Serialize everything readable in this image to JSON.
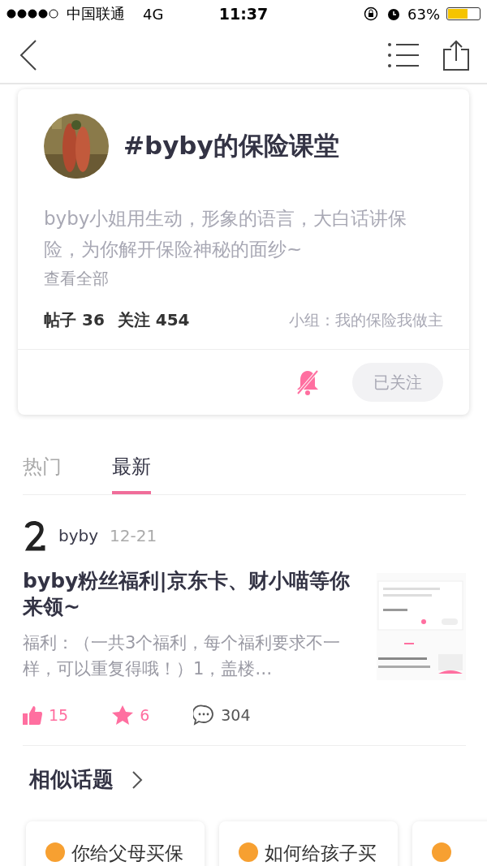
{
  "status_bar": {
    "carrier": "中国联通",
    "network": "4G",
    "time": "11:37",
    "battery": "63%"
  },
  "topic": {
    "title": "#byby的保险课堂",
    "description": "byby小姐用生动，形象的语言，大白话讲保险，为你解开保险神秘的面纱~",
    "view_all": "查看全部",
    "posts_label": "帖子",
    "posts": "36",
    "follows_label": "关注",
    "follows": "454",
    "group": "小组：我的保险我做主",
    "muted": true,
    "follow_button": "已关注",
    "followed": true
  },
  "tabs": [
    {
      "label": "热门",
      "selected": false
    },
    {
      "label": "最新",
      "selected": true
    }
  ],
  "post": {
    "author": "byby",
    "date": "12-21",
    "title": "byby粉丝福利|京东卡、财小喵等你来领~",
    "snippet": "福利：（一共3个福利，每个福利要求不一样，可以重复得哦！）1，盖楼…",
    "likes": "15",
    "stars": "6",
    "comments": "304"
  },
  "similar": {
    "title": "相似话题",
    "topics": [
      {
        "kind": "topic",
        "title": "你给父母买保"
      },
      {
        "kind": "topic",
        "title": "如何给孩子买"
      },
      {
        "kind": "topic"
      }
    ]
  }
}
